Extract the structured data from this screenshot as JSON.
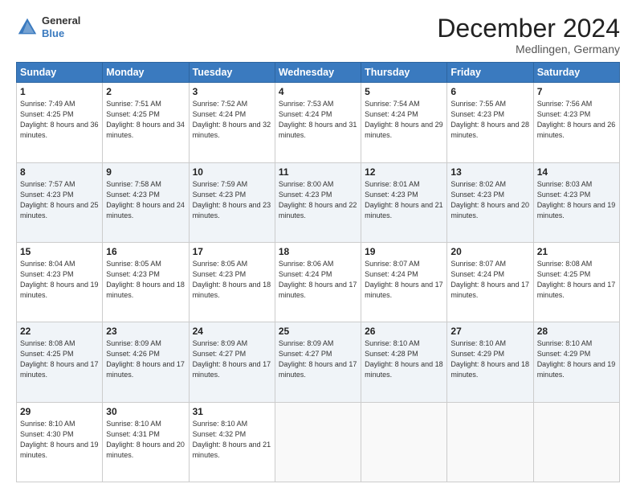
{
  "header": {
    "logo_general": "General",
    "logo_blue": "Blue",
    "month_title": "December 2024",
    "location": "Medlingen, Germany"
  },
  "days_of_week": [
    "Sunday",
    "Monday",
    "Tuesday",
    "Wednesday",
    "Thursday",
    "Friday",
    "Saturday"
  ],
  "weeks": [
    [
      {
        "day": "1",
        "sunrise": "Sunrise: 7:49 AM",
        "sunset": "Sunset: 4:25 PM",
        "daylight": "Daylight: 8 hours and 36 minutes."
      },
      {
        "day": "2",
        "sunrise": "Sunrise: 7:51 AM",
        "sunset": "Sunset: 4:25 PM",
        "daylight": "Daylight: 8 hours and 34 minutes."
      },
      {
        "day": "3",
        "sunrise": "Sunrise: 7:52 AM",
        "sunset": "Sunset: 4:24 PM",
        "daylight": "Daylight: 8 hours and 32 minutes."
      },
      {
        "day": "4",
        "sunrise": "Sunrise: 7:53 AM",
        "sunset": "Sunset: 4:24 PM",
        "daylight": "Daylight: 8 hours and 31 minutes."
      },
      {
        "day": "5",
        "sunrise": "Sunrise: 7:54 AM",
        "sunset": "Sunset: 4:24 PM",
        "daylight": "Daylight: 8 hours and 29 minutes."
      },
      {
        "day": "6",
        "sunrise": "Sunrise: 7:55 AM",
        "sunset": "Sunset: 4:23 PM",
        "daylight": "Daylight: 8 hours and 28 minutes."
      },
      {
        "day": "7",
        "sunrise": "Sunrise: 7:56 AM",
        "sunset": "Sunset: 4:23 PM",
        "daylight": "Daylight: 8 hours and 26 minutes."
      }
    ],
    [
      {
        "day": "8",
        "sunrise": "Sunrise: 7:57 AM",
        "sunset": "Sunset: 4:23 PM",
        "daylight": "Daylight: 8 hours and 25 minutes."
      },
      {
        "day": "9",
        "sunrise": "Sunrise: 7:58 AM",
        "sunset": "Sunset: 4:23 PM",
        "daylight": "Daylight: 8 hours and 24 minutes."
      },
      {
        "day": "10",
        "sunrise": "Sunrise: 7:59 AM",
        "sunset": "Sunset: 4:23 PM",
        "daylight": "Daylight: 8 hours and 23 minutes."
      },
      {
        "day": "11",
        "sunrise": "Sunrise: 8:00 AM",
        "sunset": "Sunset: 4:23 PM",
        "daylight": "Daylight: 8 hours and 22 minutes."
      },
      {
        "day": "12",
        "sunrise": "Sunrise: 8:01 AM",
        "sunset": "Sunset: 4:23 PM",
        "daylight": "Daylight: 8 hours and 21 minutes."
      },
      {
        "day": "13",
        "sunrise": "Sunrise: 8:02 AM",
        "sunset": "Sunset: 4:23 PM",
        "daylight": "Daylight: 8 hours and 20 minutes."
      },
      {
        "day": "14",
        "sunrise": "Sunrise: 8:03 AM",
        "sunset": "Sunset: 4:23 PM",
        "daylight": "Daylight: 8 hours and 19 minutes."
      }
    ],
    [
      {
        "day": "15",
        "sunrise": "Sunrise: 8:04 AM",
        "sunset": "Sunset: 4:23 PM",
        "daylight": "Daylight: 8 hours and 19 minutes."
      },
      {
        "day": "16",
        "sunrise": "Sunrise: 8:05 AM",
        "sunset": "Sunset: 4:23 PM",
        "daylight": "Daylight: 8 hours and 18 minutes."
      },
      {
        "day": "17",
        "sunrise": "Sunrise: 8:05 AM",
        "sunset": "Sunset: 4:23 PM",
        "daylight": "Daylight: 8 hours and 18 minutes."
      },
      {
        "day": "18",
        "sunrise": "Sunrise: 8:06 AM",
        "sunset": "Sunset: 4:24 PM",
        "daylight": "Daylight: 8 hours and 17 minutes."
      },
      {
        "day": "19",
        "sunrise": "Sunrise: 8:07 AM",
        "sunset": "Sunset: 4:24 PM",
        "daylight": "Daylight: 8 hours and 17 minutes."
      },
      {
        "day": "20",
        "sunrise": "Sunrise: 8:07 AM",
        "sunset": "Sunset: 4:24 PM",
        "daylight": "Daylight: 8 hours and 17 minutes."
      },
      {
        "day": "21",
        "sunrise": "Sunrise: 8:08 AM",
        "sunset": "Sunset: 4:25 PM",
        "daylight": "Daylight: 8 hours and 17 minutes."
      }
    ],
    [
      {
        "day": "22",
        "sunrise": "Sunrise: 8:08 AM",
        "sunset": "Sunset: 4:25 PM",
        "daylight": "Daylight: 8 hours and 17 minutes."
      },
      {
        "day": "23",
        "sunrise": "Sunrise: 8:09 AM",
        "sunset": "Sunset: 4:26 PM",
        "daylight": "Daylight: 8 hours and 17 minutes."
      },
      {
        "day": "24",
        "sunrise": "Sunrise: 8:09 AM",
        "sunset": "Sunset: 4:27 PM",
        "daylight": "Daylight: 8 hours and 17 minutes."
      },
      {
        "day": "25",
        "sunrise": "Sunrise: 8:09 AM",
        "sunset": "Sunset: 4:27 PM",
        "daylight": "Daylight: 8 hours and 17 minutes."
      },
      {
        "day": "26",
        "sunrise": "Sunrise: 8:10 AM",
        "sunset": "Sunset: 4:28 PM",
        "daylight": "Daylight: 8 hours and 18 minutes."
      },
      {
        "day": "27",
        "sunrise": "Sunrise: 8:10 AM",
        "sunset": "Sunset: 4:29 PM",
        "daylight": "Daylight: 8 hours and 18 minutes."
      },
      {
        "day": "28",
        "sunrise": "Sunrise: 8:10 AM",
        "sunset": "Sunset: 4:29 PM",
        "daylight": "Daylight: 8 hours and 19 minutes."
      }
    ],
    [
      {
        "day": "29",
        "sunrise": "Sunrise: 8:10 AM",
        "sunset": "Sunset: 4:30 PM",
        "daylight": "Daylight: 8 hours and 19 minutes."
      },
      {
        "day": "30",
        "sunrise": "Sunrise: 8:10 AM",
        "sunset": "Sunset: 4:31 PM",
        "daylight": "Daylight: 8 hours and 20 minutes."
      },
      {
        "day": "31",
        "sunrise": "Sunrise: 8:10 AM",
        "sunset": "Sunset: 4:32 PM",
        "daylight": "Daylight: 8 hours and 21 minutes."
      },
      null,
      null,
      null,
      null
    ]
  ]
}
